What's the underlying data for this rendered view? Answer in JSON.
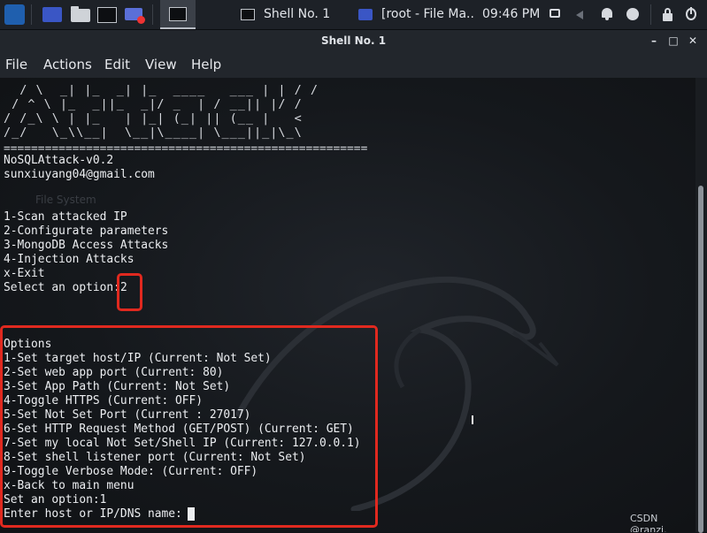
{
  "taskbar": {
    "tasks": [
      {
        "label": "Shell No. 1"
      },
      {
        "label": "[root - File Ma..."
      }
    ],
    "clock": "09:46 PM"
  },
  "window": {
    "title": "Shell No. 1",
    "minimize": "–",
    "maximize": "□",
    "close": "✕"
  },
  "menu": [
    "File",
    "Actions",
    "Edit",
    "View",
    "Help"
  ],
  "terminal": {
    "ascii_art": [
      "  / \\  _| |_  _| |_  ____   ___ | | / /",
      " / ^ \\ |_  _||_  _|/ _  | / __|| |/ /",
      "/ /_\\ \\ | |_   | |_| (_| || (__ |   < ",
      "/_/   \\_\\\\__|  \\__|\\____| \\___||_|\\_\\"
    ],
    "rule": "=====================================================",
    "version": "NoSQLAttack-v0.2",
    "email": "sunxiuyang04@gmail.com",
    "ghost_text": "File System",
    "main_menu": [
      "1-Scan attacked IP",
      "2-Configurate parameters",
      "3-MongoDB Access Attacks",
      "4-Injection Attacks",
      "x-Exit"
    ],
    "select_prompt": "Select an option:",
    "select_value": "2",
    "options_header": "Options",
    "options": [
      "1-Set target host/IP (Current: Not Set)",
      "2-Set web app port (Current: 80)",
      "3-Set App Path (Current: Not Set)",
      "4-Toggle HTTPS (Current: OFF)",
      "5-Set Not Set Port (Current : 27017)",
      "6-Set HTTP Request Method (GET/POST) (Current: GET)",
      "7-Set my local Not Set/Shell IP (Current: 127.0.0.1)",
      "8-Set shell listener port (Current: Not Set)",
      "9-Toggle Verbose Mode: (Current: OFF)",
      "x-Back to main menu"
    ],
    "set_option": "Set an option:1",
    "host_prompt": "Enter host or IP/DNS name:",
    "host_value": ""
  },
  "watermark": "CSDN @ranzi.",
  "colors": {
    "highlight": "#e0291f",
    "terminal_bg": "#15181c",
    "text": "#eceef1"
  }
}
